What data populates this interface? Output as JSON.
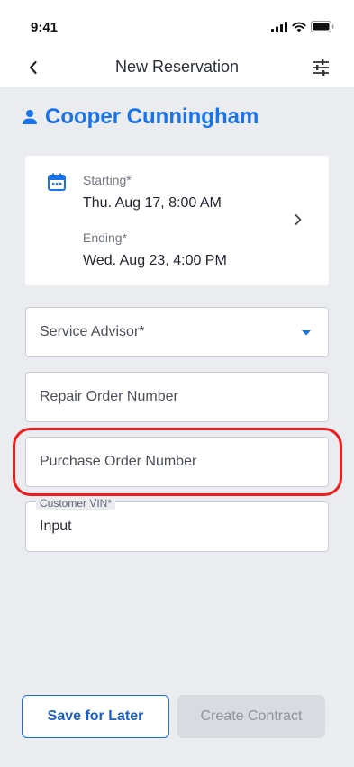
{
  "status_bar": {
    "time": "9:41",
    "icons": [
      "signal-icon",
      "wifi-icon",
      "battery-icon"
    ]
  },
  "nav": {
    "title": "New Reservation",
    "back_icon": "chevron-left-icon",
    "filter_icon": "sliders-icon"
  },
  "customer": {
    "name": "Cooper Cunningham",
    "icon": "person-icon"
  },
  "dates": {
    "starting_label": "Starting*",
    "starting_value": "Thu. Aug 17, 8:00 AM",
    "ending_label": "Ending*",
    "ending_value": "Wed. Aug 23, 4:00 PM",
    "icon": "calendar-icon"
  },
  "form": {
    "service_advisor_placeholder": "Service Advisor*",
    "repair_order_placeholder": "Repair Order Number",
    "purchase_order_placeholder": "Purchase Order Number",
    "vin_label": "Customer VIN*",
    "vin_value": "Input"
  },
  "actions": {
    "save_label": "Save for Later",
    "create_label": "Create Contract"
  },
  "colors": {
    "accent": "#1a73e8",
    "highlight": "#ee1d1d",
    "background": "#ebecf0"
  }
}
